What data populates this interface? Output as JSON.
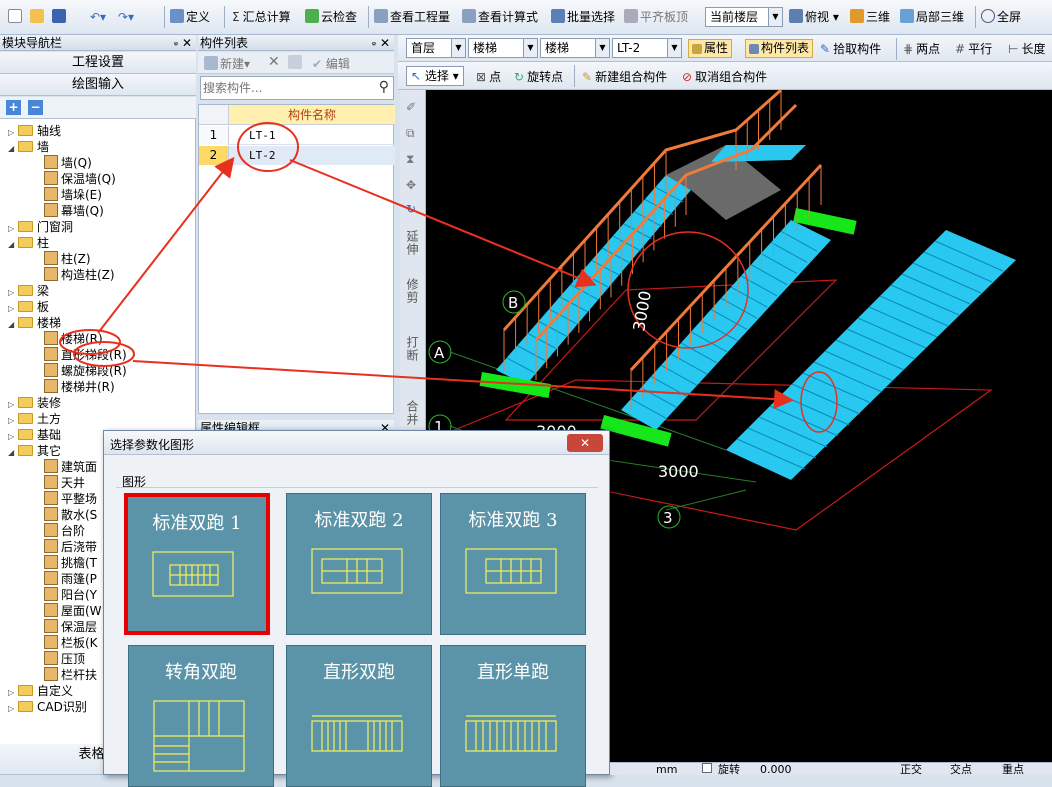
{
  "toolbar": {
    "items": [
      "定义",
      "汇总计算",
      "云检查",
      "查看工程量",
      "查看计算式",
      "批量选择",
      "平齐板顶"
    ],
    "floor_combo": "当前楼层",
    "view_items": [
      "俯视",
      "三维",
      "局部三维",
      "全屏"
    ]
  },
  "toolbar2": {
    "floor": "首层",
    "category": "楼梯",
    "type": "楼梯",
    "component": "LT-2",
    "attribute_button": "属性",
    "component_list_button": "构件列表",
    "pick_button": "拾取构件",
    "two_point": "两点",
    "parallel": "平行",
    "length": "长度"
  },
  "toolbar3": {
    "select": "选择",
    "point": "点",
    "rotate_point": "旋转点",
    "new_group": "新建组合构件",
    "cancel_group": "取消组合构件"
  },
  "nav": {
    "title": "模块导航栏",
    "project_settings": "工程设置",
    "drawing_input": "绘图输入",
    "tree": [
      {
        "label": "轴线",
        "level": 0,
        "open": false
      },
      {
        "label": "墙",
        "level": 0,
        "open": true
      },
      {
        "label": "墙(Q)",
        "level": 1
      },
      {
        "label": "保温墙(Q)",
        "level": 1
      },
      {
        "label": "墙垛(E)",
        "level": 1
      },
      {
        "label": "幕墙(Q)",
        "level": 1
      },
      {
        "label": "门窗洞",
        "level": 0,
        "open": false
      },
      {
        "label": "柱",
        "level": 0,
        "open": true
      },
      {
        "label": "柱(Z)",
        "level": 1
      },
      {
        "label": "构造柱(Z)",
        "level": 1
      },
      {
        "label": "梁",
        "level": 0,
        "open": false
      },
      {
        "label": "板",
        "level": 0,
        "open": false
      },
      {
        "label": "楼梯",
        "level": 0,
        "open": true
      },
      {
        "label": "楼梯(R)",
        "level": 1
      },
      {
        "label": "直形梯段(R)",
        "level": 1
      },
      {
        "label": "螺旋梯段(R)",
        "level": 1
      },
      {
        "label": "楼梯井(R)",
        "level": 1
      },
      {
        "label": "装修",
        "level": 0,
        "open": false
      },
      {
        "label": "土方",
        "level": 0,
        "open": false
      },
      {
        "label": "基础",
        "level": 0,
        "open": false
      },
      {
        "label": "其它",
        "level": 0,
        "open": true
      },
      {
        "label": "建筑面",
        "level": 1
      },
      {
        "label": "天井",
        "level": 1
      },
      {
        "label": "平整场",
        "level": 1
      },
      {
        "label": "散水(S",
        "level": 1
      },
      {
        "label": "台阶",
        "level": 1
      },
      {
        "label": "后浇带",
        "level": 1
      },
      {
        "label": "挑檐(T",
        "level": 1
      },
      {
        "label": "雨篷(P",
        "level": 1
      },
      {
        "label": "阳台(Y",
        "level": 1
      },
      {
        "label": "屋面(W",
        "level": 1
      },
      {
        "label": "保温层",
        "level": 1
      },
      {
        "label": "栏板(K",
        "level": 1
      },
      {
        "label": "压顶",
        "level": 1
      },
      {
        "label": "栏杆扶",
        "level": 1
      },
      {
        "label": "自定义",
        "level": 0,
        "open": false
      },
      {
        "label": "CAD识别",
        "level": 0,
        "open": false
      }
    ],
    "table_input": "表格输"
  },
  "component_list": {
    "title": "构件列表",
    "new_button": "新建",
    "edit_button": "编辑",
    "search_placeholder": "搜索构件...",
    "column_header": "构件名称",
    "rows": [
      {
        "no": "1",
        "name": "LT-1"
      },
      {
        "no": "2",
        "name": "LT-2"
      }
    ],
    "property_panel_title": "属性编辑框"
  },
  "vtools": [
    "延伸",
    "修剪",
    "打断",
    "合并"
  ],
  "canvas": {
    "axis_labels": [
      "A",
      "B",
      "1",
      "3"
    ],
    "dimensions": [
      "3000",
      "3000",
      "3000"
    ]
  },
  "dialog": {
    "title": "选择参数化图形",
    "group_label": "图形",
    "tiles": [
      "标准双跑 1",
      "标准双跑 2",
      "标准双跑 3",
      "转角双跑",
      "直形双跑",
      "直形单跑"
    ],
    "selected_index": 0
  },
  "statusbar": {
    "mm": "mm",
    "rotate": "旋转",
    "angle": "0.000",
    "ortho": "正交",
    "intersect": "交点",
    "midpoint": "重点"
  },
  "colors": {
    "stair": "#28c8f0",
    "landing": "#17e61a",
    "railing": "#f07a3a",
    "annotation": "#e8301e",
    "tile_bg": "#5b93a8",
    "selected_border": "#e60000"
  }
}
